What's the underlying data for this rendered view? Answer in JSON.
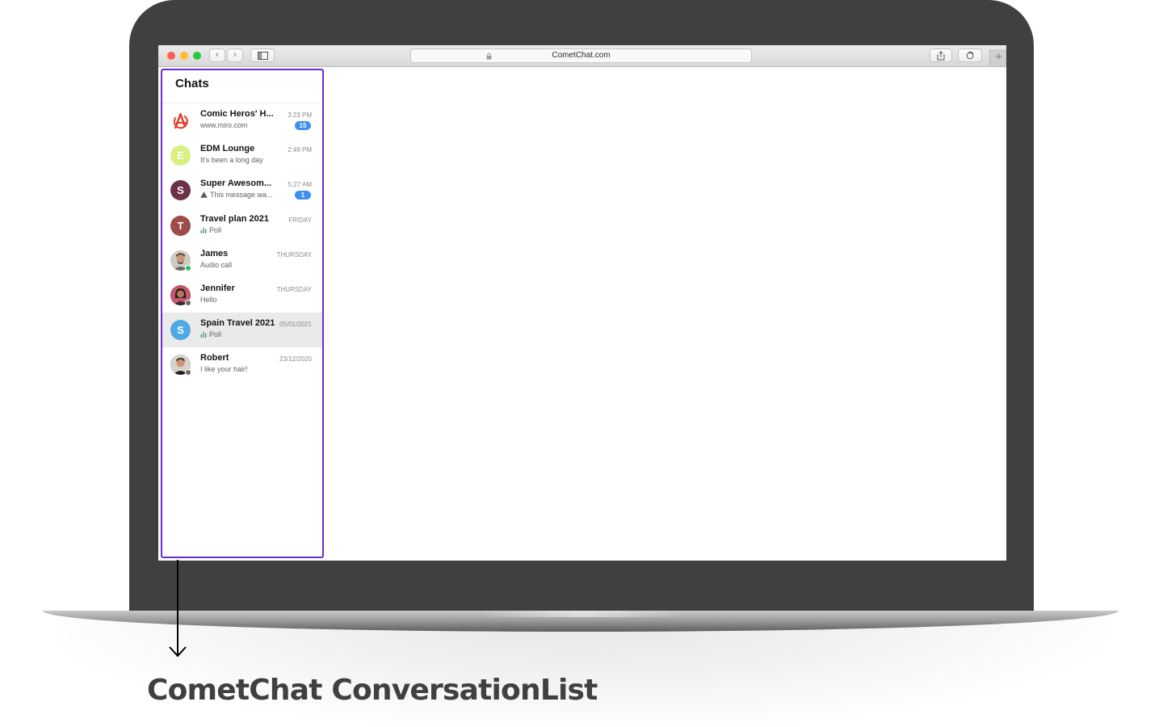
{
  "browser": {
    "url": "CometChat.com",
    "nav_back": "‹",
    "nav_forward": "›",
    "new_tab": "+"
  },
  "conversation_list": {
    "title": "Chats",
    "items": [
      {
        "name": "Comic Heros' H...",
        "preview": "www.miro.com",
        "time": "3:23 PM",
        "unread": "15",
        "avatar_type": "avengers-logo",
        "color": "#e23a2b"
      },
      {
        "name": "EDM Lounge",
        "preview": "It's been a long day",
        "time": "2:49 PM",
        "avatar_initial": "E",
        "color": "#d4f07a"
      },
      {
        "name": "Super Awesom...",
        "preview": "This message wa...",
        "preview_icon": "warning-icon",
        "time": "5:27 AM",
        "unread": "1",
        "avatar_initial": "S",
        "color": "#6b3248"
      },
      {
        "name": "Travel plan 2021",
        "preview": "Poll",
        "preview_icon": "poll-icon",
        "time": "FRIDAY",
        "avatar_initial": "T",
        "color": "#9e4b4b"
      },
      {
        "name": "James",
        "preview": "Audio call",
        "time": "THURSDAY",
        "avatar_type": "photo",
        "status": "online",
        "color": "#7c7c7c"
      },
      {
        "name": "Jennifer",
        "preview": "Hello",
        "time": "THURSDAY",
        "avatar_type": "photo",
        "status": "offline",
        "color": "#b8506a"
      },
      {
        "name": "Spain Travel 2021",
        "preview": "Poll",
        "preview_icon": "poll-icon",
        "time": "05/01/2021",
        "avatar_initial": "S",
        "color": "#4da9e2",
        "selected": true
      },
      {
        "name": "Robert",
        "preview": "I like your hair!",
        "time": "23/12/2020",
        "avatar_type": "photo",
        "status": "offline",
        "color": "#5b4a3e"
      }
    ]
  },
  "caption": "CometChat ConversationList",
  "colors": {
    "highlight_border": "#6b2bd3",
    "badge": "#3d8ff0",
    "online": "#2fbf58",
    "offline": "#6a6a6a"
  }
}
